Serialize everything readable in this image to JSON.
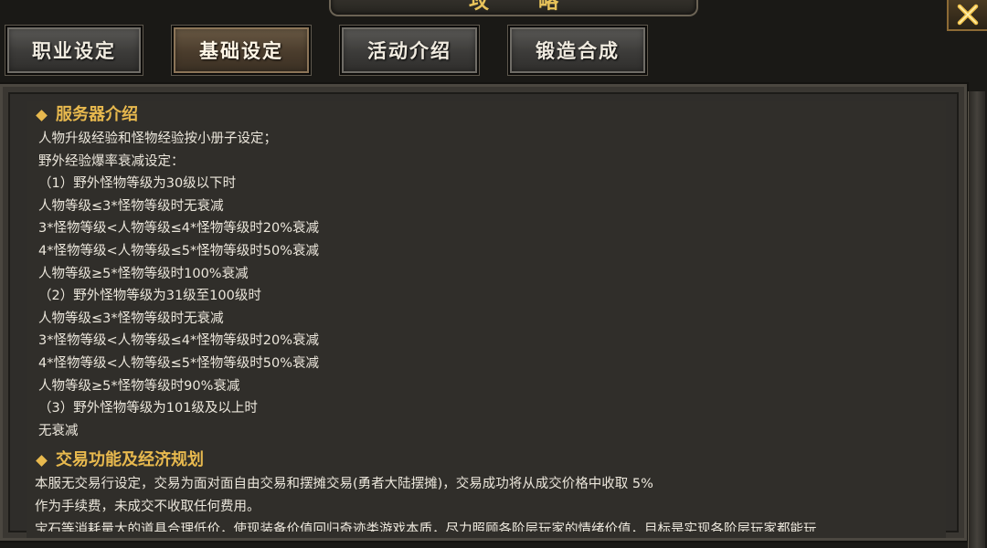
{
  "title": "攻略",
  "tabs": [
    {
      "label": "职业设定",
      "active": false
    },
    {
      "label": "基础设定",
      "active": true
    },
    {
      "label": "活动介绍",
      "active": false
    },
    {
      "label": "锻造合成",
      "active": false
    }
  ],
  "section1": {
    "heading": "服务器介绍",
    "lines": [
      "人物升级经验和怪物经验按小册子设定；",
      "野外经验爆率衰减设定：",
      "（1）野外怪物等级为30级以下时",
      "人物等级≤3*怪物等级时无衰减",
      "3*怪物等级<人物等级≤4*怪物等级时20%衰减",
      "4*怪物等级<人物等级≤5*怪物等级时50%衰减",
      "人物等级≥5*怪物等级时100%衰减",
      "（2）野外怪物等级为31级至100级时",
      "人物等级≤3*怪物等级时无衰减",
      "3*怪物等级<人物等级≤4*怪物等级时20%衰减",
      "4*怪物等级<人物等级≤5*怪物等级时50%衰减",
      "人物等级≥5*怪物等级时90%衰减",
      "（3）野外怪物等级为101级及以上时",
      "无衰减"
    ]
  },
  "section2": {
    "heading": "交易功能及经济规划",
    "lines": [
      "本服无交易行设定，交易为面对面自由交易和摆摊交易(勇者大陆摆摊)，交易成功将从成交价格中收取 5%",
      "作为手续费，未成交不收取任何费用。",
      "宝石等消耗量大的道具合理低价，使现装备价值回归奇迹类游戏本质，尽力照顾各阶层玩家的情绪价值，目标是实现各阶层玩家都能玩"
    ]
  }
}
